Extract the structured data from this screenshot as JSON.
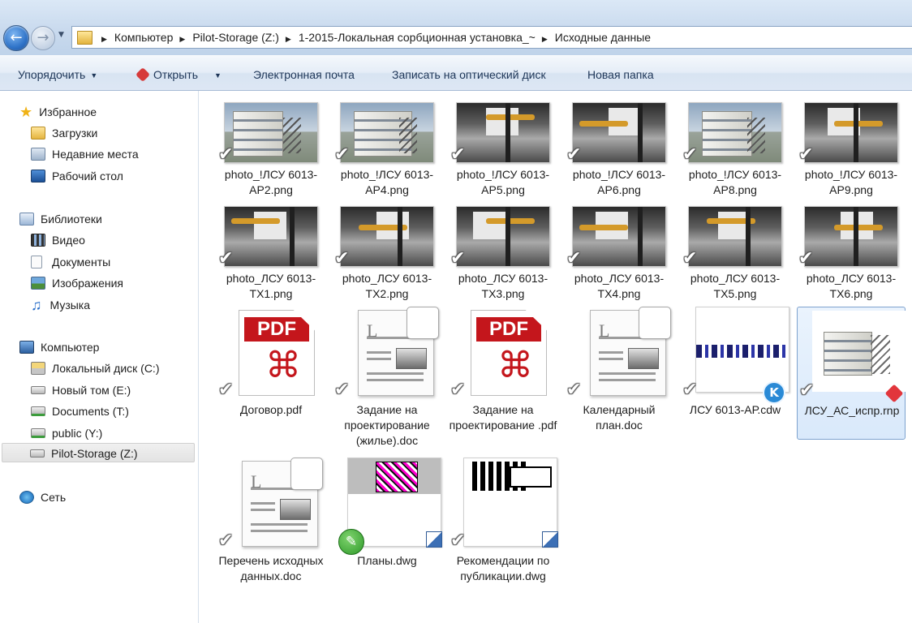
{
  "address_bar": {
    "crumbs": [
      "Компьютер",
      "Pilot-Storage (Z:)",
      "1-2015-Локальная сорбционная установка_~",
      "Исходные данные"
    ]
  },
  "toolbar": {
    "organize": "Упорядочить",
    "open": "Открыть",
    "email": "Электронная почта",
    "burn": "Записать на оптический диск",
    "new_folder": "Новая папка"
  },
  "nav": {
    "favorites": {
      "label": "Избранное",
      "items": [
        "Загрузки",
        "Недавние места",
        "Рабочий стол"
      ]
    },
    "libraries": {
      "label": "Библиотеки",
      "items": [
        "Видео",
        "Документы",
        "Изображения",
        "Музыка"
      ]
    },
    "computer": {
      "label": "Компьютер",
      "items": [
        "Локальный диск (C:)",
        "Новый том (E:)",
        "Documents (T:)",
        "public (Y:)",
        "Pilot-Storage (Z:)"
      ]
    },
    "network": {
      "label": "Сеть"
    },
    "selected": "Pilot-Storage (Z:)"
  },
  "files": [
    {
      "name": "photo_!ЛСУ 6013-АР2.png",
      "kind": "exterior"
    },
    {
      "name": "photo_!ЛСУ 6013-АР4.png",
      "kind": "exterior"
    },
    {
      "name": "photo_!ЛСУ 6013-АР5.png",
      "kind": "interior"
    },
    {
      "name": "photo_!ЛСУ 6013-АР6.png",
      "kind": "interior"
    },
    {
      "name": "photo_!ЛСУ 6013-АР8.png",
      "kind": "exterior"
    },
    {
      "name": "photo_!ЛСУ 6013-АР9.png",
      "kind": "interior"
    },
    {
      "name": "photo_ЛСУ 6013-ТХ1.png",
      "kind": "interior"
    },
    {
      "name": "photo_ЛСУ 6013-ТХ2.png",
      "kind": "interior"
    },
    {
      "name": "photo_ЛСУ 6013-ТХ3.png",
      "kind": "interior"
    },
    {
      "name": "photo_ЛСУ 6013-ТХ4.png",
      "kind": "interior"
    },
    {
      "name": "photo_ЛСУ 6013-ТХ5.png",
      "kind": "interior"
    },
    {
      "name": "photo_ЛСУ 6013-ТХ6.png",
      "kind": "interior"
    },
    {
      "name": "Договор.pdf",
      "kind": "pdf"
    },
    {
      "name": "Задание на проектирование (жилье).doc",
      "kind": "doc"
    },
    {
      "name": "Задание на проектирование .pdf",
      "kind": "pdf"
    },
    {
      "name": "Календарный план.doc",
      "kind": "doc"
    },
    {
      "name": "ЛСУ 6013-АР.cdw",
      "kind": "cdw"
    },
    {
      "name": "ЛСУ_АС_испр.rnp",
      "kind": "rnp"
    },
    {
      "name": "Перечень исходных данных.doc",
      "kind": "doc"
    },
    {
      "name": "Планы.dwg",
      "kind": "dwg"
    },
    {
      "name": "Рекомендации по публикации.dwg",
      "kind": "dwg2"
    }
  ],
  "selected_file": "ЛСУ_АС_испр.rnp",
  "icons": {
    "pdf_label": "PDF",
    "doc_letter": "L",
    "cdw_badge": "K"
  }
}
